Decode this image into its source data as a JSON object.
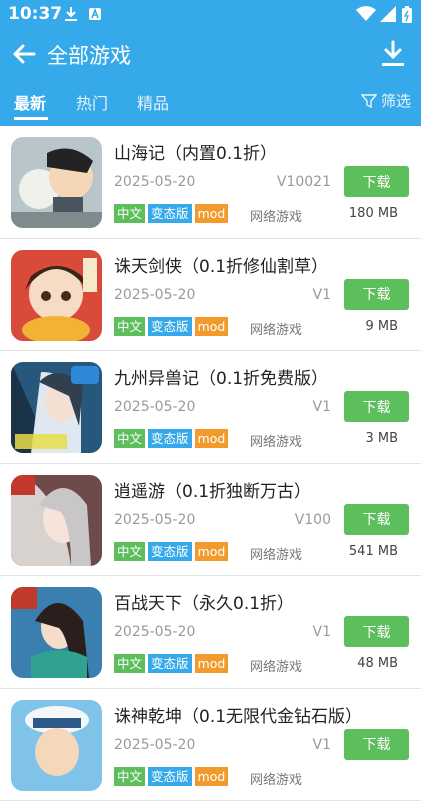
{
  "status": {
    "time": "10:37"
  },
  "header": {
    "title": "全部游戏"
  },
  "tabs": [
    {
      "label": "最新"
    },
    {
      "label": "热门"
    },
    {
      "label": "精品"
    }
  ],
  "filter": {
    "label": "筛选"
  },
  "colors": {
    "primary": "#35a9ea",
    "download": "#5cbf5c",
    "tag_cn": "#5cbf5c",
    "tag_mod": "#f39a2c"
  },
  "games": [
    {
      "name": "山海记（内置0.1折）",
      "date": "2025-05-20",
      "version": "V10021",
      "download": "下载",
      "tags": [
        "中文",
        "变态版",
        "mod"
      ],
      "category": "网络游戏",
      "size": "180 MB"
    },
    {
      "name": "诛天剑侠（0.1折修仙割草）",
      "date": "2025-05-20",
      "version": "V1",
      "download": "下载",
      "tags": [
        "中文",
        "变态版",
        "mod"
      ],
      "category": "网络游戏",
      "size": "9 MB"
    },
    {
      "name": "九州异兽记（0.1折免费版）",
      "date": "2025-05-20",
      "version": "V1",
      "download": "下载",
      "tags": [
        "中文",
        "变态版",
        "mod"
      ],
      "category": "网络游戏",
      "size": "3 MB"
    },
    {
      "name": "逍遥游（0.1折独断万古）",
      "date": "2025-05-20",
      "version": "V100",
      "download": "下载",
      "tags": [
        "中文",
        "变态版",
        "mod"
      ],
      "category": "网络游戏",
      "size": "541 MB"
    },
    {
      "name": "百战天下（永久0.1折）",
      "date": "2025-05-20",
      "version": "V1",
      "download": "下载",
      "tags": [
        "中文",
        "变态版",
        "mod"
      ],
      "category": "网络游戏",
      "size": "48 MB"
    },
    {
      "name": "诛神乾坤（0.1无限代金钻石版）",
      "date": "2025-05-20",
      "version": "V1",
      "download": "下载",
      "tags": [
        "中文",
        "变态版",
        "mod"
      ],
      "category": "网络游戏",
      "size": ""
    }
  ]
}
